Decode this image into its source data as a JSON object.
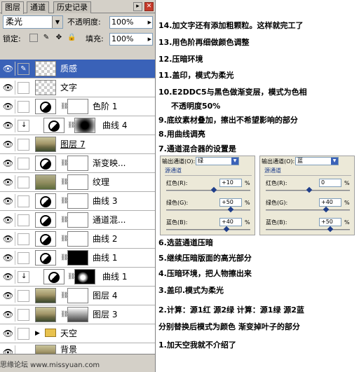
{
  "tabs": [
    "图层",
    "通道",
    "历史记录"
  ],
  "window_buttons": [
    "▸",
    "✕"
  ],
  "blend_mode": "柔光",
  "opacity_label": "不透明度:",
  "opacity_value": "100%",
  "lock_label": "锁定:",
  "fill_label": "填充:",
  "fill_value": "100%",
  "layers": [
    {
      "name": "质感",
      "kind": "pixel",
      "selected": true
    },
    {
      "name": "文字",
      "kind": "pixel"
    },
    {
      "name": "色阶 1",
      "kind": "adjust"
    },
    {
      "name": "曲线 4",
      "kind": "adjust"
    },
    {
      "name": "图层 7",
      "kind": "photo"
    },
    {
      "name": "渐变映...",
      "kind": "adjust"
    },
    {
      "name": "纹理",
      "kind": "photo"
    },
    {
      "name": "曲线 3",
      "kind": "adjust"
    },
    {
      "name": "通道混...",
      "kind": "adjust"
    },
    {
      "name": "曲线 2",
      "kind": "adjust"
    },
    {
      "name": "曲线 1",
      "kind": "adjust"
    },
    {
      "name": "曲线 1",
      "kind": "adjust"
    },
    {
      "name": "图层 4",
      "kind": "photo"
    },
    {
      "name": "图层 3",
      "kind": "photo"
    },
    {
      "name": "天空",
      "kind": "folder"
    },
    {
      "name": "背景",
      "kind": "pixel"
    }
  ],
  "notes": [
    "14.加文字还有添加粗颗粒。这样就完工了",
    "13.用色阶再细做颜色调整",
    "12.压暗环境",
    "11.盖印，模式为柔光",
    "10.E2DDC5与黑色做渐变层，模式为色相",
    "不透明度50%",
    "9.底纹素材叠加，擦出不希望影响的部分",
    "8.用曲线调亮",
    "7.通道混合器的设置是",
    "6.选蓝通道压暗",
    "5.继续压暗版面的高光部分",
    "4.压暗环境，把人物擦出来",
    "3.盖印.模式为柔光",
    "2.计算：源1红  源2绿  计算：源1绿  源2蓝",
    "分别替换后模式为颜色    渐变掉叶子的部分",
    "1.加天空我就不介绍了"
  ],
  "mixers": [
    {
      "output_label": "输出通道(O):",
      "channel": "绿",
      "source_label": "源通道",
      "red_label": "红色(R):",
      "red": "+10",
      "green_label": "绿色(G):",
      "green": "+50",
      "blue_label": "蓝色(B):",
      "blue": "+40",
      "pct": "%"
    },
    {
      "output_label": "输出通道(O):",
      "channel": "蓝",
      "source_label": "源通道",
      "red_label": "红色(R):",
      "red": "0",
      "green_label": "绿色(G):",
      "green": "+40",
      "blue_label": "蓝色(B):",
      "blue": "+50",
      "pct": "%"
    }
  ],
  "watermark": "思缘论坛  www.missyuan.com"
}
